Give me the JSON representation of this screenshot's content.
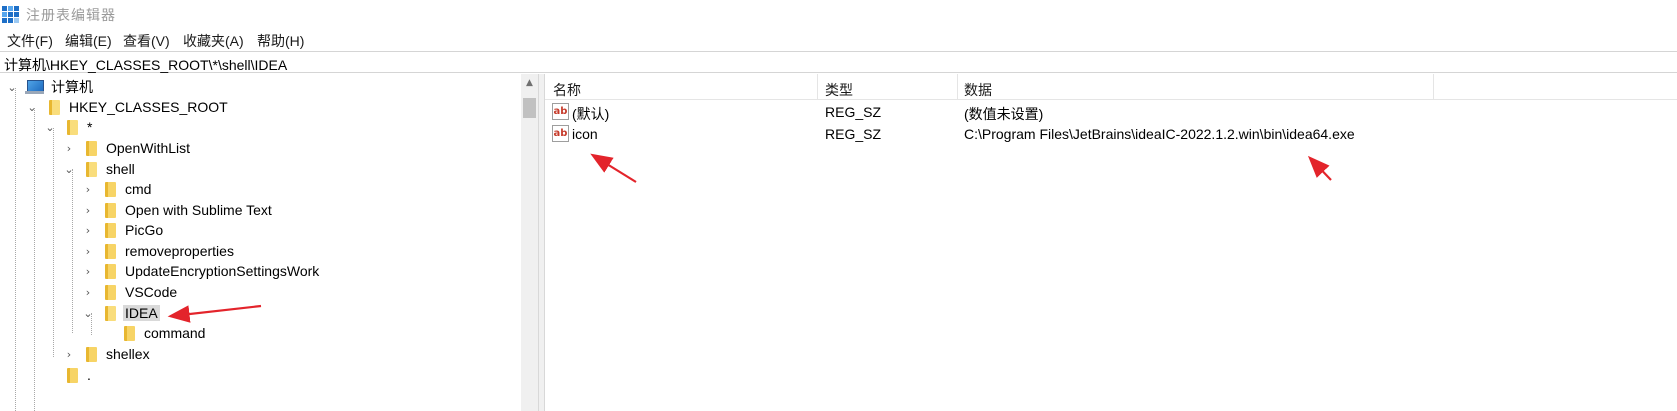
{
  "window": {
    "title": "注册表编辑器"
  },
  "menu": [
    "文件(F)",
    "编辑(E)",
    "查看(V)",
    "收藏夹(A)",
    "帮助(H)"
  ],
  "address": "计算机\\HKEY_CLASSES_ROOT\\*\\shell\\IDEA",
  "tree": {
    "computer": "计算机",
    "hkcr": "HKEY_CLASSES_ROOT",
    "star": "*",
    "openwithlist": "OpenWithList",
    "shell": "shell",
    "cmd": "cmd",
    "sublime": "Open with Sublime Text",
    "picgo": "PicGo",
    "removeproperties": "removeproperties",
    "updateenc": "UpdateEncryptionSettingsWork",
    "vscode": "VSCode",
    "idea": "IDEA",
    "command": "command",
    "shellex": "shellex",
    "dot": "."
  },
  "columns": {
    "name": "名称",
    "type": "类型",
    "data": "数据"
  },
  "values": [
    {
      "name": "(默认)",
      "type": "REG_SZ",
      "data": "(数值未设置)"
    },
    {
      "name": "icon",
      "type": "REG_SZ",
      "data": "C:\\Program Files\\JetBrains\\ideaIC-2022.1.2.win\\bin\\idea64.exe"
    }
  ],
  "icons": {
    "app": "registry-editor-icon",
    "value": "string-value-icon",
    "annotation_color": "#e3242b"
  }
}
